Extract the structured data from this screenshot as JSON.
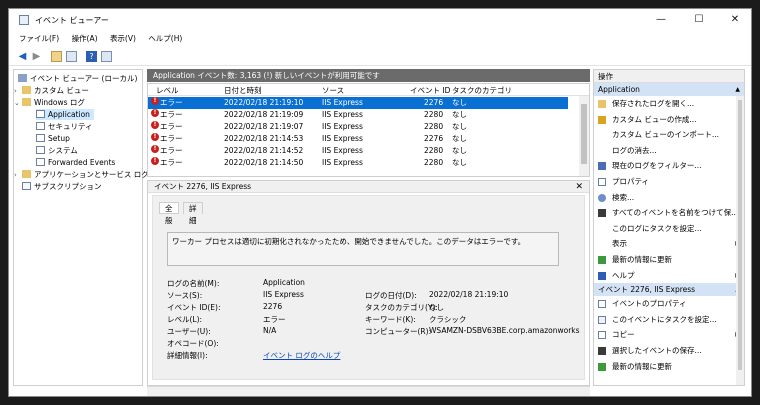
{
  "window": {
    "title": "イベント ビューアー",
    "minimize": "—",
    "maximize": "☐",
    "close": "✕"
  },
  "menu": [
    "ファイル(F)",
    "操作(A)",
    "表示(V)",
    "ヘルプ(H)"
  ],
  "tree": {
    "root": "イベント ビューアー (ローカル)",
    "custom_views": "カスタム ビュー",
    "windows_logs": "Windows ログ",
    "application": "Application",
    "security": "セキュリティ",
    "setup": "Setup",
    "system": "システム",
    "forwarded": "Forwarded Events",
    "app_service_logs": "アプリケーションとサービス ログ",
    "subscriptions": "サブスクリプション"
  },
  "log_header": "Application   イベント数: 3,163 (!) 新しいイベントが利用可能です",
  "columns": {
    "level": "レベル",
    "datetime": "日付と時刻",
    "source": "ソース",
    "event_id": "イベント ID",
    "category": "タスクのカテゴリ"
  },
  "rows": [
    {
      "level": "エラー",
      "datetime": "2022/02/18 21:19:10",
      "source": "IIS Express",
      "event_id": "2276",
      "category": "なし"
    },
    {
      "level": "エラー",
      "datetime": "2022/02/18 21:19:09",
      "source": "IIS Express",
      "event_id": "2280",
      "category": "なし"
    },
    {
      "level": "エラー",
      "datetime": "2022/02/18 21:19:07",
      "source": "IIS Express",
      "event_id": "2280",
      "category": "なし"
    },
    {
      "level": "エラー",
      "datetime": "2022/02/18 21:14:53",
      "source": "IIS Express",
      "event_id": "2276",
      "category": "なし"
    },
    {
      "level": "エラー",
      "datetime": "2022/02/18 21:14:52",
      "source": "IIS Express",
      "event_id": "2280",
      "category": "なし"
    },
    {
      "level": "エラー",
      "datetime": "2022/02/18 21:14:50",
      "source": "IIS Express",
      "event_id": "2280",
      "category": "なし"
    }
  ],
  "detail": {
    "title": "イベント 2276, IIS Express",
    "close": "✕",
    "tab_general": "全般",
    "tab_details": "詳細",
    "message": "ワーカー プロセスは適切に初期化されなかったため、開始できませんでした。このデータはエラーです。",
    "labels": {
      "log_name": "ログの名前(M):",
      "source": "ソース(S):",
      "event_id": "イベント ID(E):",
      "level": "レベル(L):",
      "user": "ユーザー(U):",
      "opcode": "オペコード(O):",
      "more_info": "詳細情報(I):",
      "logged": "ログの日付(D):",
      "task_category": "タスクのカテゴリ(Y):",
      "keywords": "キーワード(K):",
      "computer": "コンピューター(R):"
    },
    "values": {
      "log_name": "Application",
      "source": "IIS Express",
      "event_id": "2276",
      "level": "エラー",
      "user": "N/A",
      "opcode": "",
      "more_info": "イベント ログのヘルプ",
      "logged": "2022/02/18 21:19:10",
      "task_category": "なし",
      "keywords": "クラシック",
      "computer": "WSAMZN-DSBV63BE.corp.amazonworks"
    }
  },
  "actions": {
    "header": "操作",
    "section1": "Application",
    "items1": [
      "保存されたログを開く...",
      "カスタム ビューの作成...",
      "カスタム ビューのインポート...",
      "ログの消去...",
      "現在のログをフィルター...",
      "プロパティ",
      "検索...",
      "すべてのイベントを名前をつけて保...",
      "このログにタスクを設定...",
      "表示",
      "最新の情報に更新",
      "ヘルプ"
    ],
    "section2": "イベント 2276, IIS Express",
    "items2": [
      "イベントのプロパティ",
      "このイベントにタスクを設定...",
      "コピー",
      "選択したイベントの保存...",
      "最新の情報に更新"
    ]
  }
}
